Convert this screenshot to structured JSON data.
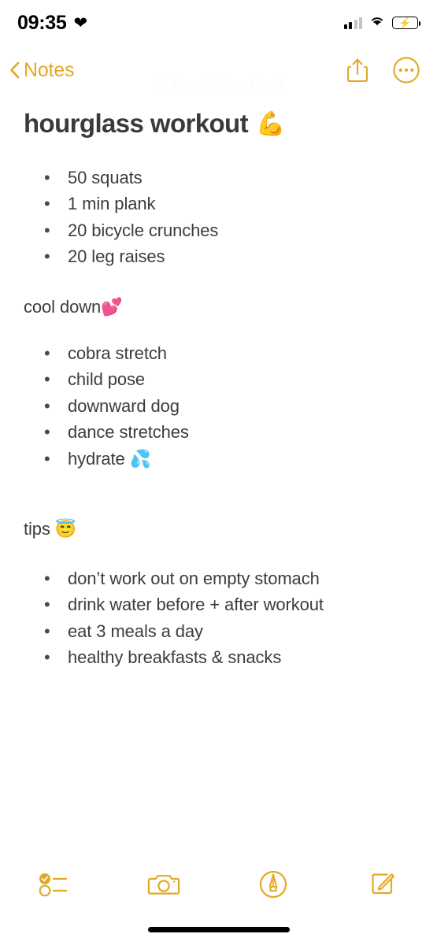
{
  "status_bar": {
    "time": "09:35",
    "heart_icon": "black-heart",
    "signal_icon": "cellular-signal-2-of-4",
    "wifi_icon": "wifi",
    "battery_icon": "battery-charging",
    "battery_color": "#3bd144"
  },
  "nav_bar": {
    "back_label": "Notes",
    "back_icon": "chevron-left-icon",
    "share_icon": "share-icon",
    "more_icon": "more-ellipsis-icon",
    "accent_color": "#E3A924"
  },
  "note": {
    "timestamp": "28 May 2023 at 09:34",
    "title": "hourglass workout",
    "title_emoji": "💪",
    "workout_items": [
      "50 squats",
      "1 min plank",
      "20 bicycle crunches",
      "20 leg raises"
    ],
    "cooldown_heading": "cool down💕",
    "cooldown_items": [
      "cobra stretch",
      "child pose",
      "downward dog",
      "hydrate 💦"
    ],
    "cooldown_items_full": [
      "cobra stretch",
      "child pose",
      "downward dog",
      "dance stretches",
      "hydrate 💦"
    ],
    "tips_heading": "tips 😇",
    "tips_items": [
      "don’t work out on empty stomach",
      "drink water before + after workout",
      "eat 3 meals a day",
      "healthy breakfasts & snacks"
    ],
    "text_color": "#3c3c3c"
  },
  "toolbar": {
    "checklist_icon": "checklist-icon",
    "camera_icon": "camera-icon",
    "markup_icon": "markup-pen-icon",
    "compose_icon": "compose-icon",
    "accent_color": "#E3A924"
  }
}
